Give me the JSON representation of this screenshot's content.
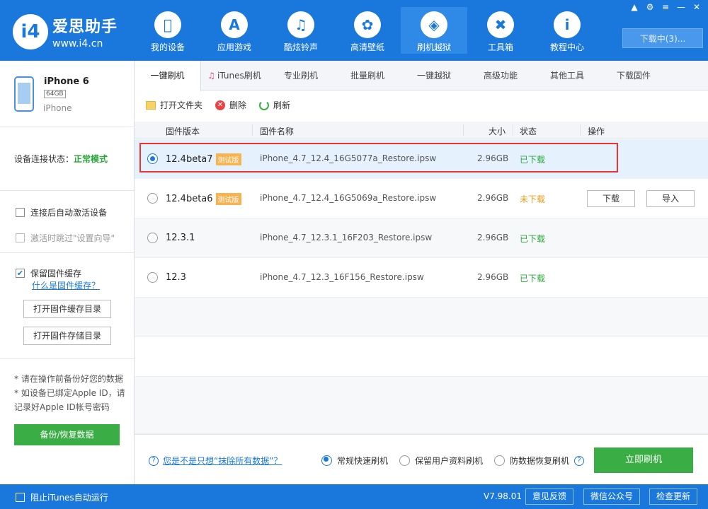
{
  "app": {
    "logo_mark": "i4",
    "name": "爱思助手",
    "url": "www.i4.cn"
  },
  "nav": [
    {
      "label": "我的设备",
      "icon": "apple-icon"
    },
    {
      "label": "应用游戏",
      "icon": "app-store-icon"
    },
    {
      "label": "酷炫铃声",
      "icon": "bell-icon"
    },
    {
      "label": "高清壁纸",
      "icon": "flower-icon"
    },
    {
      "label": "刷机越狱",
      "icon": "dropbox-icon"
    },
    {
      "label": "工具箱",
      "icon": "tools-icon"
    },
    {
      "label": "教程中心",
      "icon": "info-icon"
    }
  ],
  "download_label": "下载中(3)...",
  "device": {
    "name": "iPhone 6",
    "capacity": "64GB",
    "model": "iPhone",
    "status_label": "设备连接状态：",
    "status_value": "正常模式"
  },
  "options": {
    "auto_activate": "连接后自动激活设备",
    "skip_wizard": "激活时跳过\"设置向导\"",
    "keep_cache": "保留固件缓存",
    "what_cache": "什么是固件缓存？",
    "open_cache_dir": "打开固件缓存目录",
    "open_store_dir": "打开固件存储目录"
  },
  "notes": [
    "* 请在操作前备份好您的数据",
    "* 如设备已绑定Apple ID，请记录好Apple ID帐号密码"
  ],
  "backup_label": "备份/恢复数据",
  "tabs": [
    "一键刷机",
    "iTunes刷机",
    "专业刷机",
    "批量刷机",
    "一键越狱",
    "高级功能",
    "其他工具",
    "下载固件"
  ],
  "toolbar": {
    "open_folder": "打开文件夹",
    "delete": "删除",
    "refresh": "刷新"
  },
  "table": {
    "headers": {
      "version": "固件版本",
      "name": "固件名称",
      "size": "大小",
      "status": "状态",
      "action": "操作"
    },
    "rows": [
      {
        "version": "12.4beta7",
        "beta": "测试版",
        "name": "iPhone_4.7_12.4_16G5077a_Restore.ipsw",
        "size": "2.96GB",
        "status": "已下载"
      },
      {
        "version": "12.4beta6",
        "beta": "测试版",
        "name": "iPhone_4.7_12.4_16G5069a_Restore.ipsw",
        "size": "2.96GB",
        "status": "未下载",
        "download": "下载",
        "import": "导入"
      },
      {
        "version": "12.3.1",
        "name": "iPhone_4.7_12.3.1_16F203_Restore.ipsw",
        "size": "2.96GB",
        "status": "已下载"
      },
      {
        "version": "12.3",
        "name": "iPhone_4.7_12.3_16F156_Restore.ipsw",
        "size": "2.96GB",
        "status": "已下载"
      }
    ]
  },
  "bottom": {
    "help_link": "您是不是只想“抹除所有数据”？",
    "mode_fast": "常规快速刷机",
    "mode_keep": "保留用户资料刷机",
    "mode_recover": "防数据恢复刷机",
    "flash_now": "立即刷机"
  },
  "footer": {
    "block_itunes": "阻止iTunes自动运行",
    "version": "V7.98.01",
    "feedback": "意见反馈",
    "wechat": "微信公众号",
    "check_update": "检查更新"
  },
  "colors": {
    "brand_blue": "#1a78dc",
    "green": "#3aad45",
    "warning": "#f09a1a",
    "highlight": "#e33333"
  }
}
